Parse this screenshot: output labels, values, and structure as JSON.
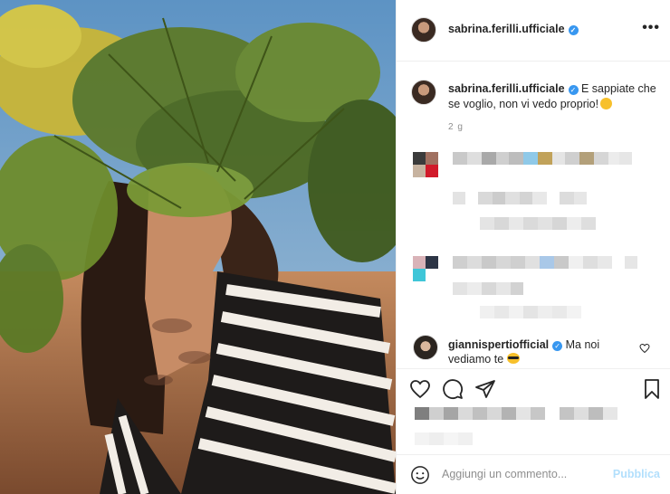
{
  "post": {
    "author": "sabrina.ferilli.ufficiale",
    "more_label": "•••",
    "caption_author": "sabrina.ferilli.ufficiale",
    "caption_text": "E sappiate che se voglio, non vi vedo proprio!",
    "time_ago": "2 g"
  },
  "comment": {
    "author": "giannispertiofficial",
    "text": "Ma noi vediamo te"
  },
  "add_comment": {
    "placeholder": "Aggiungi un commento...",
    "publish": "Pubblica"
  },
  "colors": {
    "verified": "#3897f0",
    "publish_disabled": "#b2dffc",
    "text": "#262626",
    "muted": "#8e8e8e"
  },
  "icons": [
    "verified-icon",
    "more-icon",
    "heart-icon",
    "comment-icon",
    "share-icon",
    "bookmark-icon",
    "smiley-icon"
  ]
}
